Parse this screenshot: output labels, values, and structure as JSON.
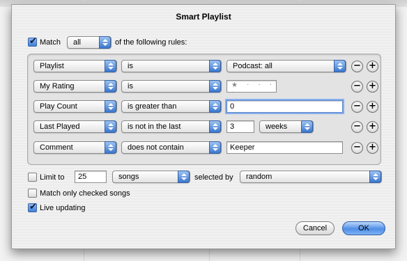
{
  "dialog": {
    "title": "Smart Playlist"
  },
  "match": {
    "checked": true,
    "label_before": "Match",
    "quantifier": "all",
    "label_after": "of the following rules:"
  },
  "rules": [
    {
      "field": "Playlist",
      "operator": "is",
      "value_popup": "Podcast: all"
    },
    {
      "field": "My Rating",
      "operator": "is",
      "stars": "★ · · · ·"
    },
    {
      "field": "Play Count",
      "operator": "is greater than",
      "value": "0"
    },
    {
      "field": "Last Played",
      "operator": "is not in the last",
      "value": "3",
      "unit": "weeks"
    },
    {
      "field": "Comment",
      "operator": "does not contain",
      "value": "Keeper"
    }
  ],
  "rule_buttons": {
    "remove": "−",
    "add": "+"
  },
  "limit": {
    "checked": false,
    "label": "Limit to",
    "value": "25",
    "unit": "songs",
    "selected_by_label": "selected by",
    "selected_by": "random"
  },
  "match_checked": {
    "checked": false,
    "label": "Match only checked songs"
  },
  "live_updating": {
    "checked": true,
    "label": "Live updating"
  },
  "buttons": {
    "cancel": "Cancel",
    "ok": "OK"
  },
  "colors": {
    "accent": "#3b77cf",
    "sheet": "#ececec"
  }
}
